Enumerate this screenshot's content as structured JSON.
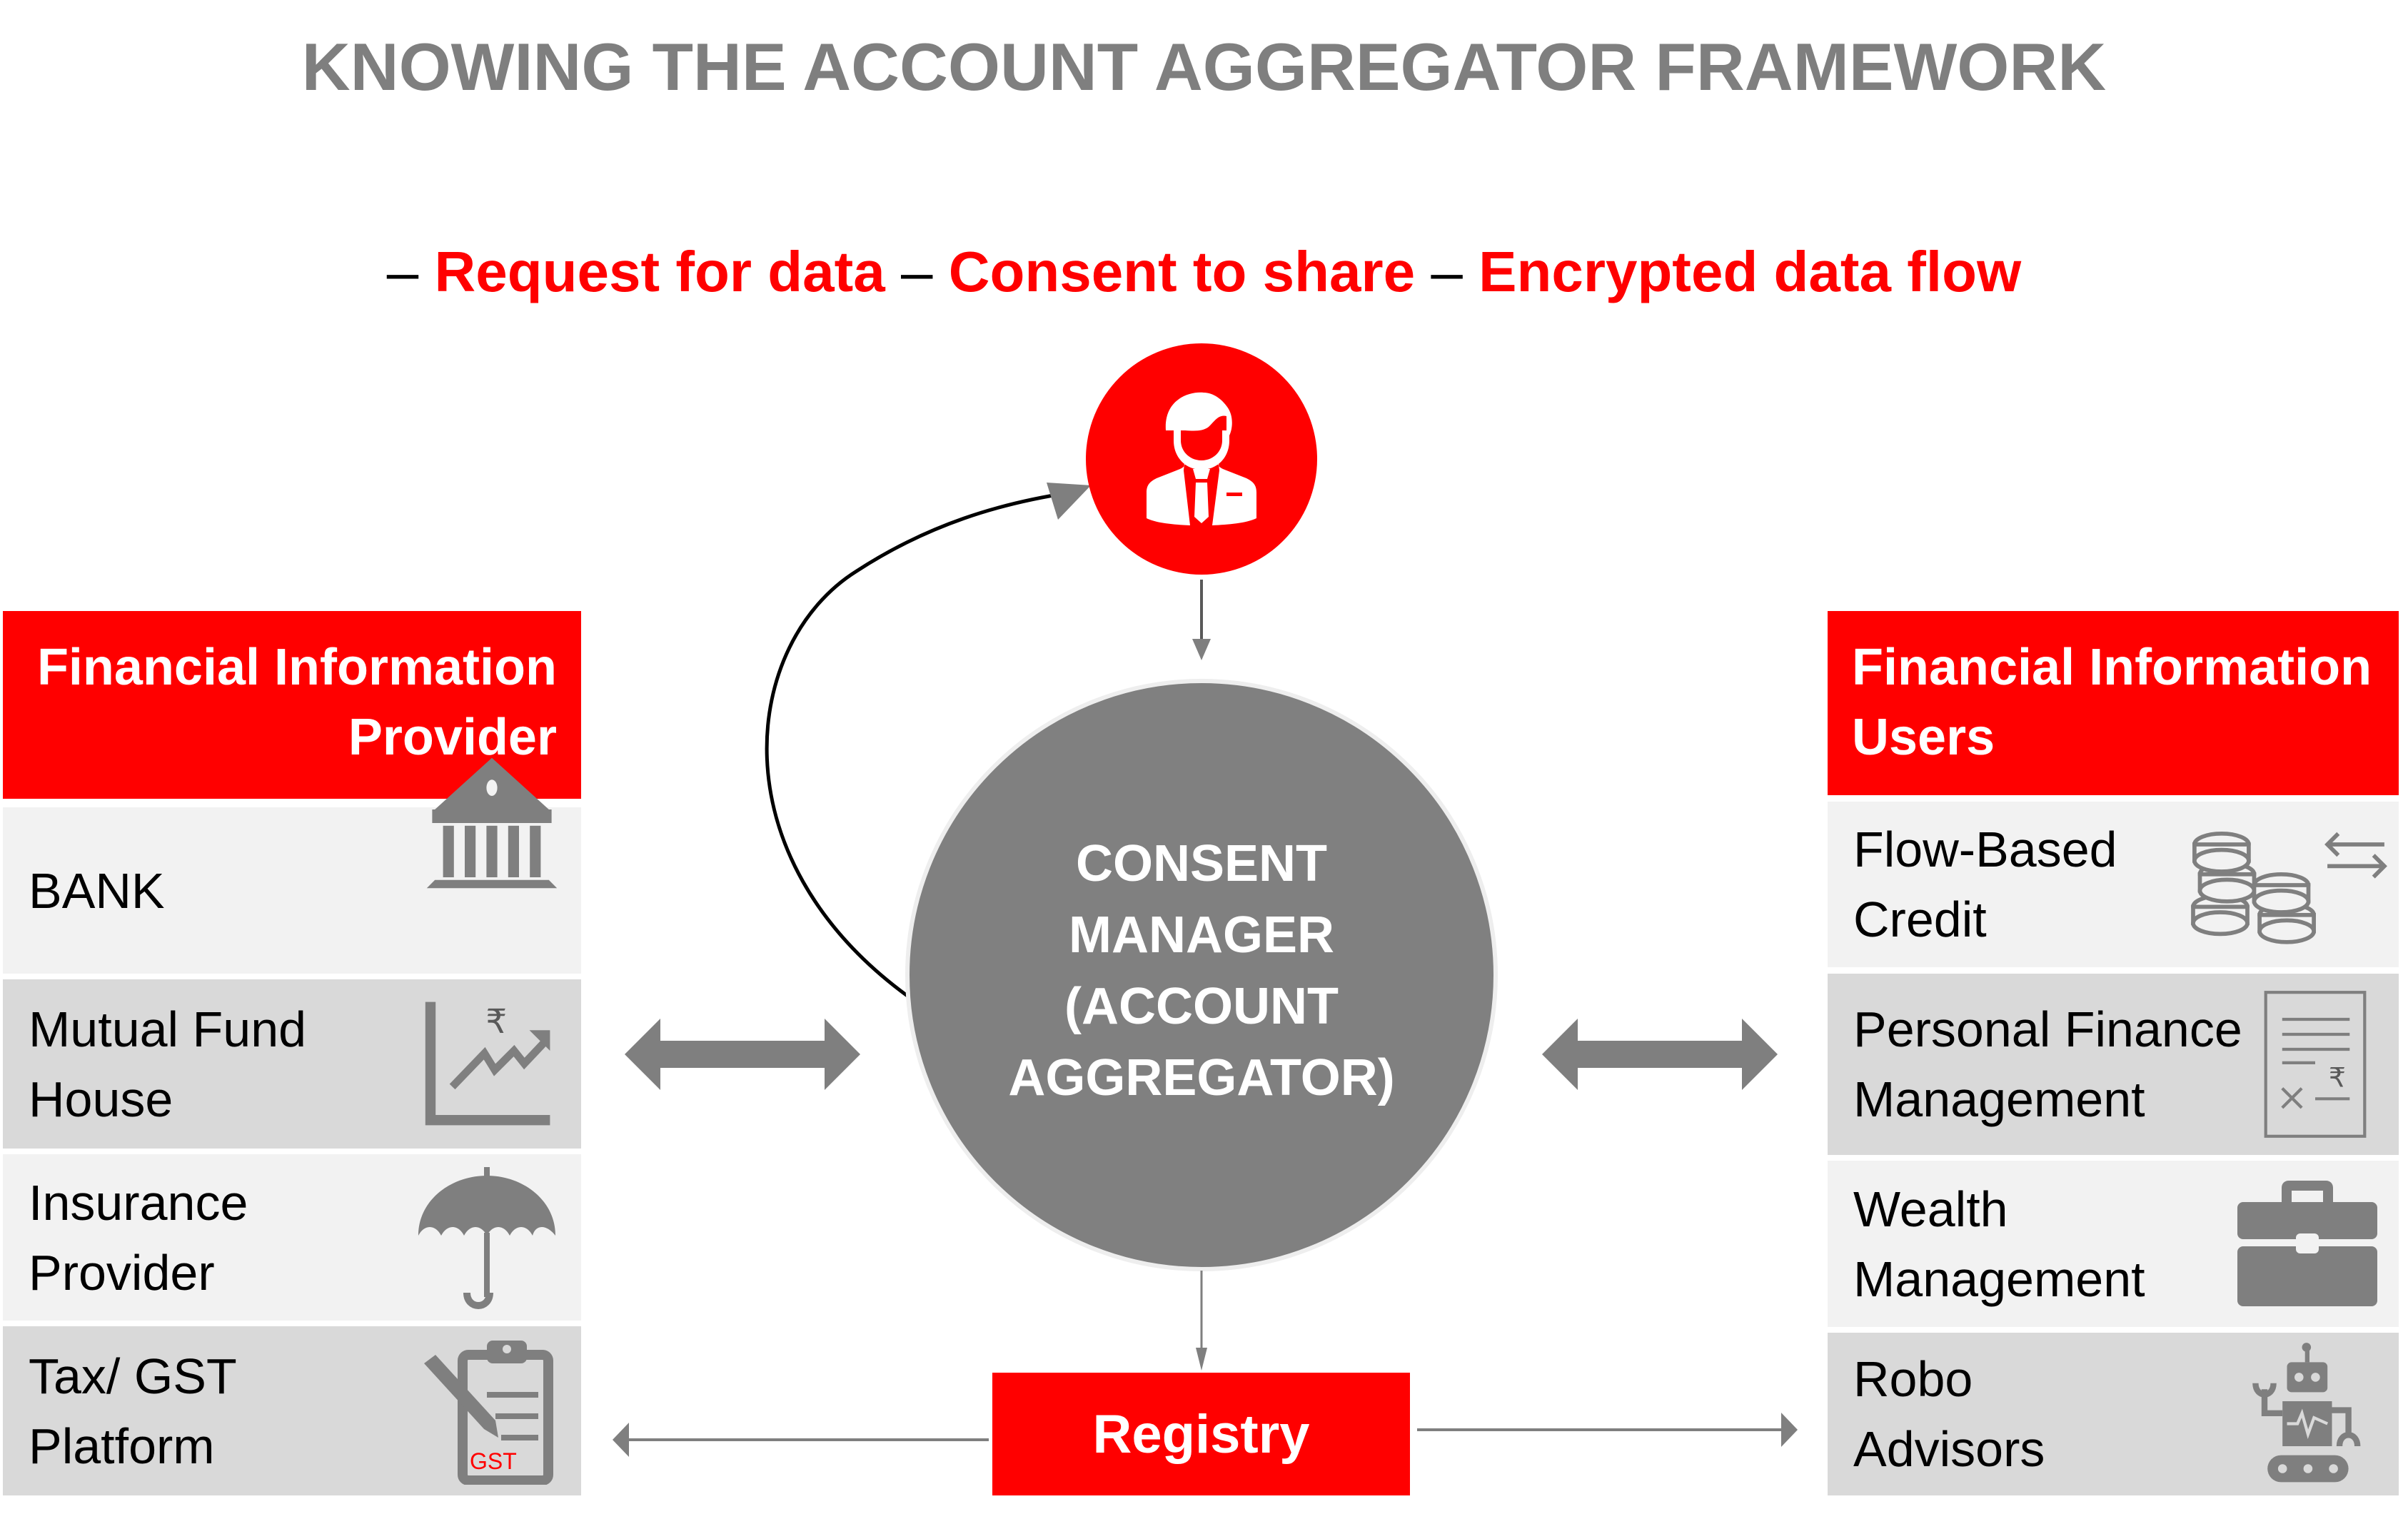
{
  "title": "KNOWING THE ACCOUNT AGGREGATOR FRAMEWORK",
  "legend": {
    "dash": "–",
    "items": [
      "Request for data",
      "Consent to share",
      "Encrypted data flow"
    ]
  },
  "colors": {
    "accent": "#ff0000",
    "gray": "#7f7f7f",
    "row_light": "#f2f2f2",
    "row_dark": "#d9d9d9"
  },
  "user_node": {
    "icon": "businessman-icon"
  },
  "center_node": {
    "lines": [
      "CONSENT",
      "MANAGER",
      "(ACCOUNT",
      "AGGREGATOR)"
    ]
  },
  "registry": {
    "label": "Registry"
  },
  "providers": {
    "header_lines": [
      "Financial Information",
      "Provider"
    ],
    "items": [
      {
        "lines": [
          "BANK"
        ],
        "icon": "bank-icon"
      },
      {
        "lines": [
          "Mutual Fund",
          "House"
        ],
        "icon": "rupee-growth-chart-icon"
      },
      {
        "lines": [
          "Insurance",
          "Provider"
        ],
        "icon": "umbrella-icon"
      },
      {
        "lines": [
          "Tax/ GST",
          "Platform"
        ],
        "icon": "gst-clipboard-icon",
        "icon_badge": "GST"
      }
    ]
  },
  "users": {
    "header_lines": [
      "Financial Information",
      "Users"
    ],
    "items": [
      {
        "lines": [
          "Flow-Based",
          "Credit"
        ],
        "icon": "coins-exchange-icon"
      },
      {
        "lines": [
          "Personal Finance",
          "Management"
        ],
        "icon": "rupee-invoice-icon"
      },
      {
        "lines": [
          "Wealth",
          "Management"
        ],
        "icon": "briefcase-icon"
      },
      {
        "lines": [
          "Robo",
          "Advisors"
        ],
        "icon": "robot-icon"
      }
    ]
  }
}
